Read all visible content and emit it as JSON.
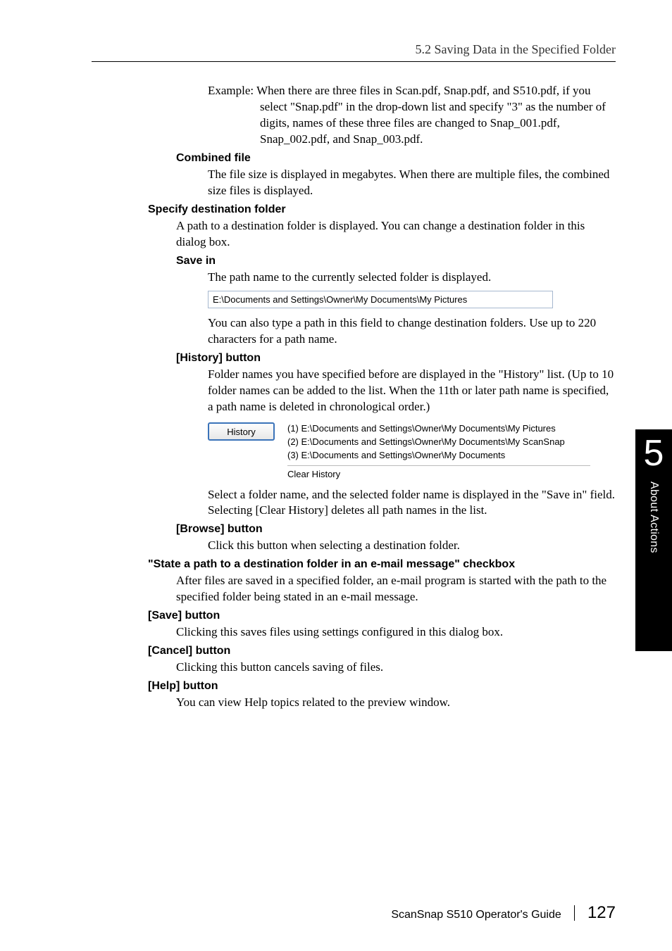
{
  "header": {
    "section_title": "5.2 Saving Data in the Specified Folder"
  },
  "example": {
    "text": "Example: When there are three files in Scan.pdf, Snap.pdf, and S510.pdf, if you select \"Snap.pdf\" in the drop-down list and specify \"3\" as the number of digits, names of these three files are changed to Snap_001.pdf, Snap_002.pdf, and Snap_003.pdf."
  },
  "combined": {
    "heading": "Combined file",
    "text": "The file size is displayed in megabytes. When there are multiple files, the combined size files is displayed."
  },
  "specify": {
    "heading": "Specify destination folder",
    "text": "A path to a destination folder is displayed. You can change a destination folder in this dialog box."
  },
  "savein": {
    "heading": "Save in",
    "text1": "The path name to the currently selected folder is displayed.",
    "path_value": "E:\\Documents and Settings\\Owner\\My Documents\\My Pictures",
    "text2": "You can also type a path in this field to change destination folders. Use up to 220 characters for a path name."
  },
  "history": {
    "heading": "[History] button",
    "text1": "Folder names you have specified before are displayed in the \"History\" list. (Up to 10 folder names can be added to the list. When the 11th or later path name is specified, a path name is deleted in chronological order.)",
    "button_label": "History",
    "item1": "(1) E:\\Documents and Settings\\Owner\\My Documents\\My Pictures",
    "item2": "(2) E:\\Documents and Settings\\Owner\\My Documents\\My ScanSnap",
    "item3": "(3) E:\\Documents and Settings\\Owner\\My Documents",
    "clear": "Clear History",
    "text2": "Select a folder name, and the selected folder name is displayed in the \"Save in\" field.",
    "text3": "Selecting [Clear History] deletes all path names in the list."
  },
  "browse": {
    "heading": "[Browse] button",
    "text": "Click this button when selecting a destination folder."
  },
  "state": {
    "heading": "\"State a path to a destination folder in an e-mail message\" checkbox",
    "text": "After files are saved in a specified folder, an e-mail program is started with the path to the specified folder being stated in an e-mail message."
  },
  "save": {
    "heading": "[Save] button",
    "text": "Clicking this saves files using settings configured in this dialog box."
  },
  "cancel": {
    "heading": "[Cancel] button",
    "text": "Clicking this button cancels saving of files."
  },
  "help": {
    "heading": "[Help] button",
    "text": "You can view Help topics related to the preview window."
  },
  "sidetab": {
    "number": "5",
    "label": "About Actions"
  },
  "footer": {
    "guide": "ScanSnap S510 Operator's Guide",
    "page": "127"
  }
}
